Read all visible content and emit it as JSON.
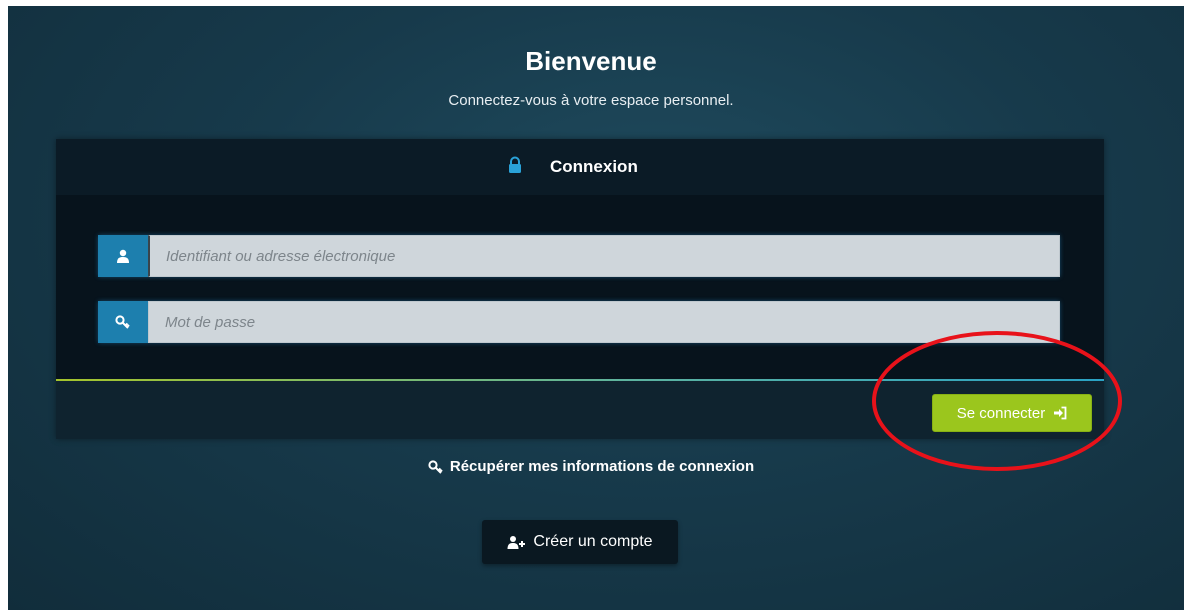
{
  "header": {
    "title": "Bienvenue",
    "subtitle": "Connectez-vous à votre espace personnel."
  },
  "panel": {
    "title": "Connexion",
    "title_icon": "lock-icon",
    "username": {
      "icon": "user-icon",
      "value": "",
      "placeholder": "Identifiant ou adresse électronique"
    },
    "password": {
      "icon": "key-icon",
      "value": "",
      "placeholder": "Mot de passe"
    },
    "login_button": {
      "label": "Se connecter",
      "icon": "sign-in-icon"
    }
  },
  "links": {
    "recover": {
      "icon": "key-icon",
      "label": "Récupérer mes informations de connexion"
    },
    "create_account": {
      "icon": "user-plus-icon",
      "label": "Créer un compte"
    }
  },
  "annotation": {
    "shape": "ellipse",
    "color": "#e8121a",
    "target": "login_button"
  },
  "colors": {
    "accent_blue": "#1d7fae",
    "button_green": "#9bc61d",
    "panel_dark": "#07131c",
    "background": "#173a4b"
  }
}
